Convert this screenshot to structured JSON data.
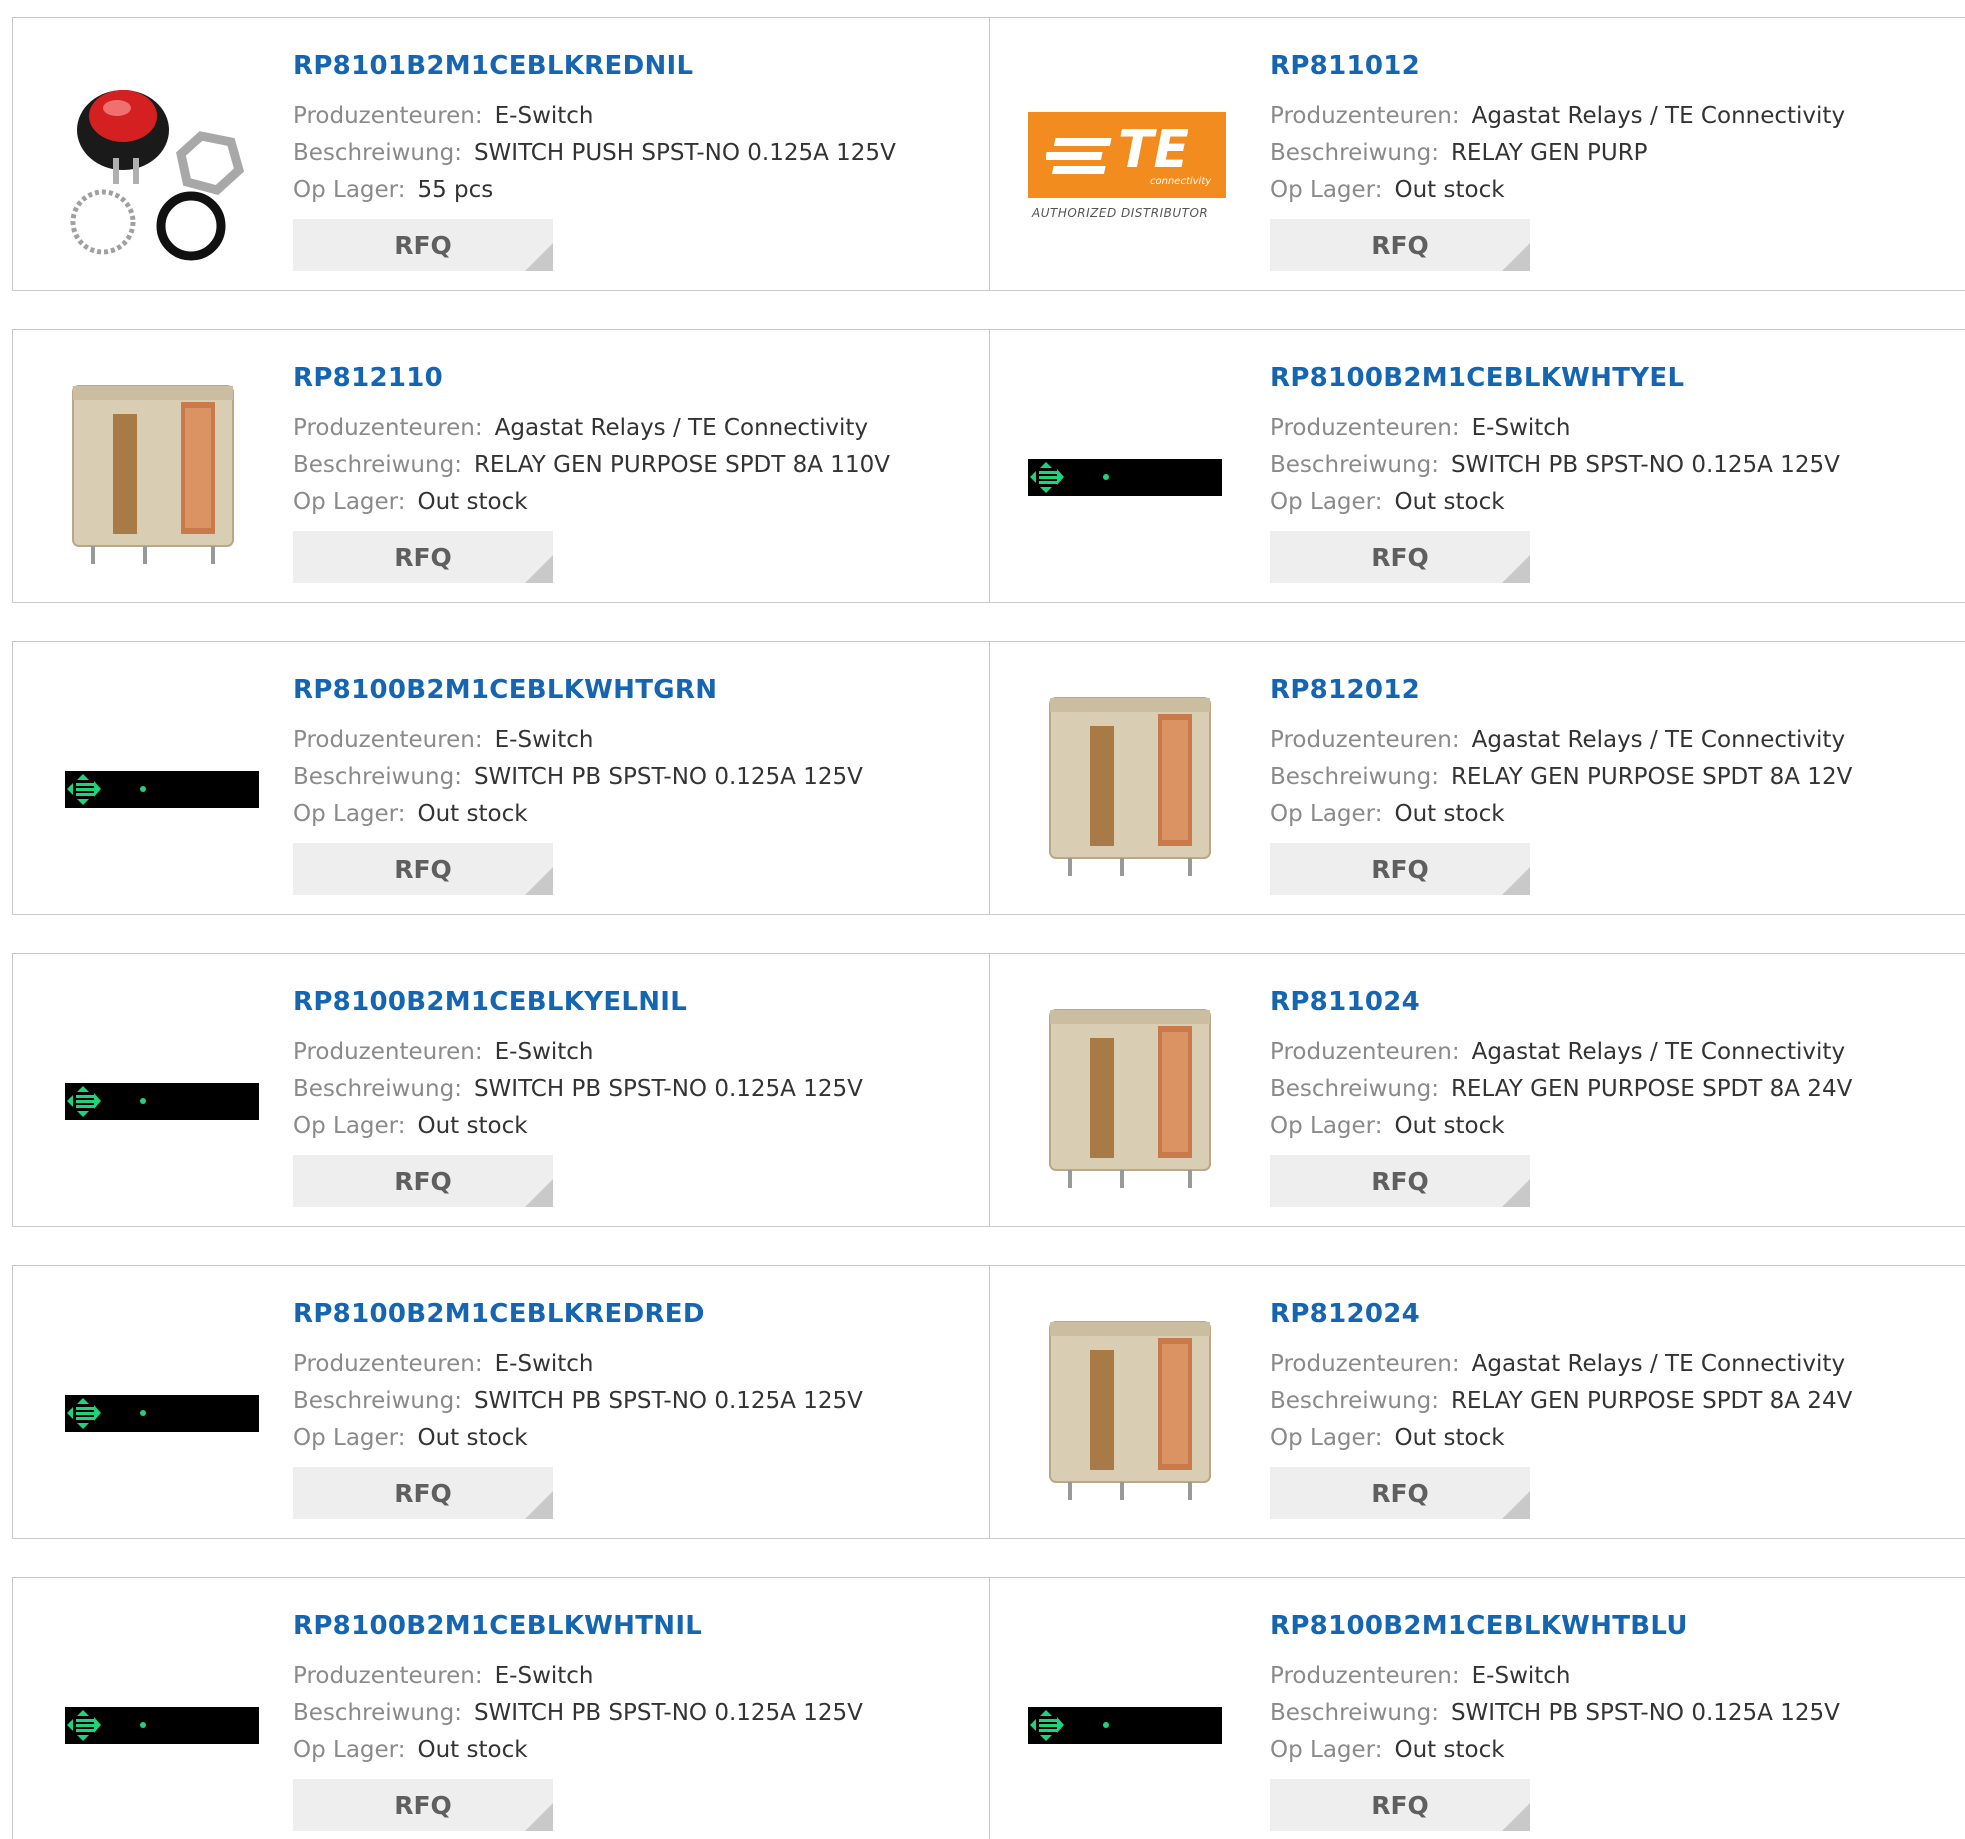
{
  "labels": {
    "manufacturer": "Produzenteuren:",
    "description": "Beschreiwung:",
    "stock": "Op Lager:",
    "rfq": "RFQ"
  },
  "te_logo": {
    "brand": "TE",
    "sub": "connectivity",
    "caption": "AUTHORIZED DISTRIBUTOR",
    "color": "#f28c1e"
  },
  "colors": {
    "part_link": "#1565b0",
    "label": "#8a8a8a",
    "value": "#333333",
    "button_bg": "#eeeeee",
    "border": "#c8c8c8",
    "bar_icon": "#1fd37a"
  },
  "products": [
    {
      "part": "RP8101B2M1CEBLKREDNIL",
      "manufacturer": "E-Switch",
      "description": "SWITCH PUSH SPST-NO 0.125A 125V",
      "stock": "55 pcs",
      "image": "pushbutton-switch-icon"
    },
    {
      "part": "RP811012",
      "manufacturer": "Agastat Relays / TE Connectivity",
      "description": "RELAY GEN PURP",
      "stock": "Out stock",
      "image": "te-logo"
    },
    {
      "part": "RP812110",
      "manufacturer": "Agastat Relays / TE Connectivity",
      "description": "RELAY GEN PURPOSE SPDT 8A 110V",
      "stock": "Out stock",
      "image": "relay-icon"
    },
    {
      "part": "RP8100B2M1CEBLKWHTYEL",
      "manufacturer": "E-Switch",
      "description": "SWITCH PB SPST-NO 0.125A 125V",
      "stock": "Out stock",
      "image": "bar-placeholder-icon"
    },
    {
      "part": "RP8100B2M1CEBLKWHTGRN",
      "manufacturer": "E-Switch",
      "description": "SWITCH PB SPST-NO 0.125A 125V",
      "stock": "Out stock",
      "image": "bar-placeholder-icon"
    },
    {
      "part": "RP812012",
      "manufacturer": "Agastat Relays / TE Connectivity",
      "description": "RELAY GEN PURPOSE SPDT 8A 12V",
      "stock": "Out stock",
      "image": "relay-icon"
    },
    {
      "part": "RP8100B2M1CEBLKYELNIL",
      "manufacturer": "E-Switch",
      "description": "SWITCH PB SPST-NO 0.125A 125V",
      "stock": "Out stock",
      "image": "bar-placeholder-icon"
    },
    {
      "part": "RP811024",
      "manufacturer": "Agastat Relays / TE Connectivity",
      "description": "RELAY GEN PURPOSE SPDT 8A 24V",
      "stock": "Out stock",
      "image": "relay-icon"
    },
    {
      "part": "RP8100B2M1CEBLKREDRED",
      "manufacturer": "E-Switch",
      "description": "SWITCH PB SPST-NO 0.125A 125V",
      "stock": "Out stock",
      "image": "bar-placeholder-icon"
    },
    {
      "part": "RP812024",
      "manufacturer": "Agastat Relays / TE Connectivity",
      "description": "RELAY GEN PURPOSE SPDT 8A 24V",
      "stock": "Out stock",
      "image": "relay-icon"
    },
    {
      "part": "RP8100B2M1CEBLKWHTNIL",
      "manufacturer": "E-Switch",
      "description": "SWITCH PB SPST-NO 0.125A 125V",
      "stock": "Out stock",
      "image": "bar-placeholder-icon"
    },
    {
      "part": "RP8100B2M1CEBLKWHTBLU",
      "manufacturer": "E-Switch",
      "description": "SWITCH PB SPST-NO 0.125A 125V",
      "stock": "Out stock",
      "image": "bar-placeholder-icon"
    }
  ]
}
